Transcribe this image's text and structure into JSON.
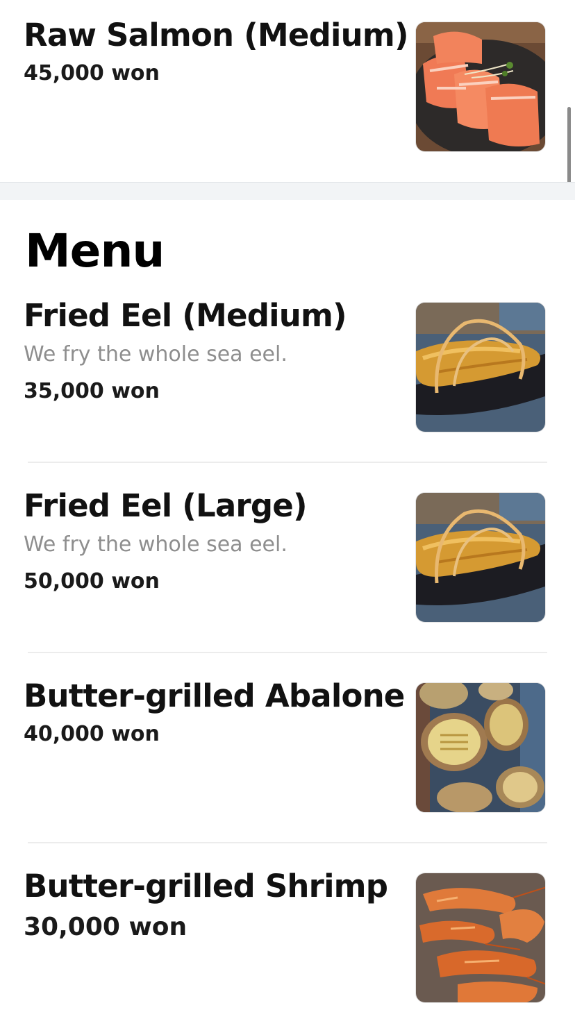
{
  "featured": {
    "name": "Raw Salmon (Medium)",
    "price": "45,000 won",
    "image_icon": "salmon-sashimi-photo"
  },
  "menu": {
    "title": "Menu",
    "items": [
      {
        "name": "Fried Eel (Medium)",
        "description": "We fry the whole sea eel.",
        "price": "35,000 won",
        "image_icon": "fried-eel-photo"
      },
      {
        "name": "Fried Eel (Large)",
        "description": "We fry the whole sea eel.",
        "price": "50,000 won",
        "image_icon": "fried-eel-photo"
      },
      {
        "name": "Butter-grilled Abalone",
        "price": "40,000 won",
        "image_icon": "grilled-abalone-photo"
      },
      {
        "name": "Butter-grilled Shrimp",
        "price": "30,000 won",
        "image_icon": "grilled-shrimp-photo"
      }
    ]
  },
  "colors": {
    "description_gray": "#8e8e8e",
    "section_gap": "#f2f4f6",
    "divider": "#ececec"
  }
}
